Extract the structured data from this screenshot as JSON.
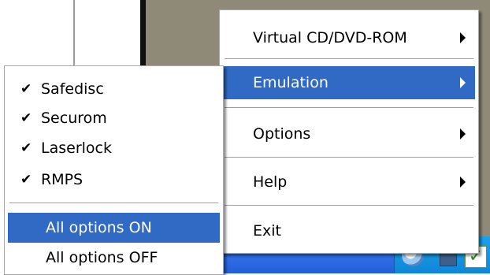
{
  "main_menu": {
    "items": [
      {
        "label": "Virtual CD/DVD-ROM",
        "has_submenu": true,
        "selected": false
      },
      {
        "label": "Emulation",
        "has_submenu": true,
        "selected": true
      },
      {
        "label": "Options",
        "has_submenu": true,
        "selected": false
      },
      {
        "label": "Help",
        "has_submenu": true,
        "selected": false
      },
      {
        "label": "Exit",
        "has_submenu": false,
        "selected": false
      }
    ]
  },
  "emulation_submenu": {
    "items": [
      {
        "label": "Safedisc",
        "checked": true
      },
      {
        "label": "Securom",
        "checked": true
      },
      {
        "label": "Laserlock",
        "checked": true
      },
      {
        "label": "RMPS",
        "checked": true
      }
    ],
    "actions": [
      {
        "label": "All options ON",
        "selected": true
      },
      {
        "label": "All options OFF",
        "selected": false
      }
    ],
    "check_glyph": "✔"
  },
  "tray": {
    "icons": [
      "cd-drive-icon",
      "network-icon",
      "checkmark-icon"
    ],
    "check_glyph": "✓"
  },
  "colors": {
    "highlight": "#316ac5",
    "taskbar": "#245edb",
    "desktop": "#8f8a78"
  }
}
